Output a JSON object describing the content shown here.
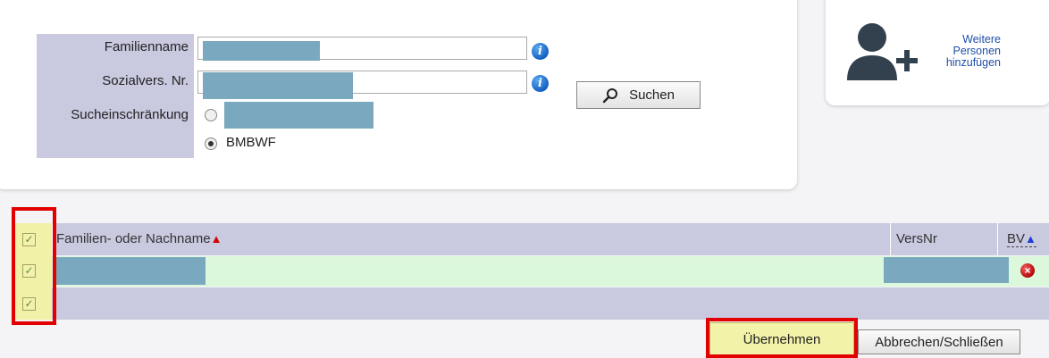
{
  "search_form": {
    "family_name_label": "Familienname",
    "sv_nr_label": "Sozialvers. Nr.",
    "restriction_label": "Sucheinschränkung",
    "restriction_options": [
      {
        "label": "",
        "selected": false
      },
      {
        "label": "BMBWF",
        "selected": true
      }
    ],
    "search_button_label": "Suchen"
  },
  "add_persons": {
    "line1": "Weitere",
    "line2": "Personen",
    "line3": "hinzufügen"
  },
  "table": {
    "columns": {
      "name": "Familien- oder Nachname",
      "versnr": "VersNr",
      "bv": "BV"
    },
    "sort_up_glyph": "▲",
    "rows": [
      {
        "name": "",
        "versnr": "",
        "checked": true
      }
    ]
  },
  "actions": {
    "accept_label": "Übernehmen",
    "cancel_label": "Abbrechen/Schließen"
  },
  "colors": {
    "label_bg": "#c9c9e0",
    "row_highlight": "#dcf8dc",
    "redaction": "#7aa8be",
    "annotation_red": "#e30000"
  }
}
